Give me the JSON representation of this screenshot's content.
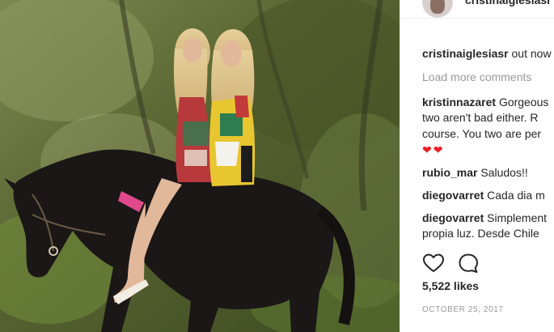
{
  "post": {
    "author": "cristinaiglesiasr",
    "caption_user": "cristinaiglesiasr",
    "caption_text": "out now",
    "load_more": "Load more comments",
    "comments": [
      {
        "user": "kristinnazaret",
        "lines": [
          "Gorgeous",
          "two aren't bad either. R",
          "course. You two are per"
        ],
        "emoji": "❤❤"
      },
      {
        "user": "rubio_mar",
        "lines": [
          "Saludos!!"
        ]
      },
      {
        "user": "diegovarret",
        "lines": [
          "Cada dia m"
        ]
      },
      {
        "user": "diegovarret",
        "lines": [
          "Simplement",
          "propia luz. Desde Chile"
        ]
      }
    ],
    "likes": "5,522 likes",
    "date": "OCTOBER 25, 2017"
  },
  "icons": {
    "like": "heart-icon",
    "comment": "comment-icon"
  },
  "colors": {
    "text": "#262626",
    "muted": "#999999",
    "divider": "#efefef",
    "heart": "#ed1c24"
  }
}
